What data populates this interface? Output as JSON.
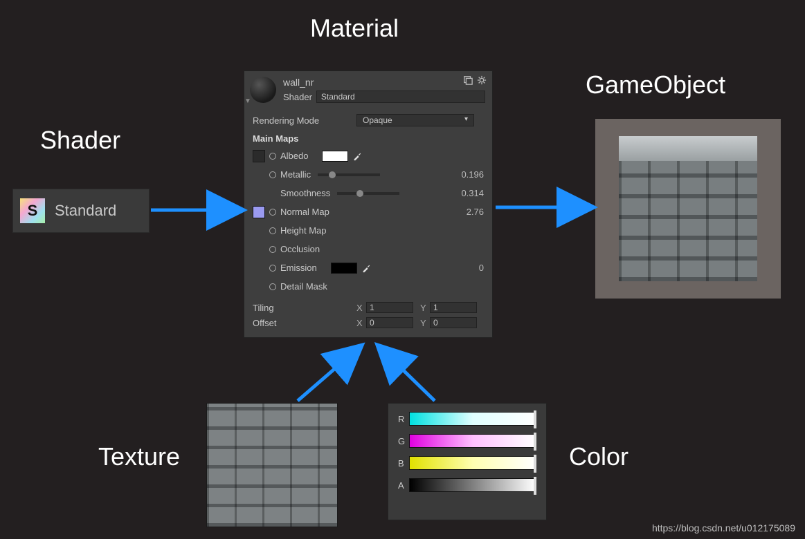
{
  "labels": {
    "material": "Material",
    "shader": "Shader",
    "gameobject": "GameObject",
    "texture": "Texture",
    "color": "Color"
  },
  "shader_block": {
    "icon_letter": "S",
    "name": "Standard"
  },
  "inspector": {
    "material_name": "wall_nr",
    "shader_label": "Shader",
    "shader_value": "Standard",
    "rendering_mode_label": "Rendering Mode",
    "rendering_mode_value": "Opaque",
    "main_maps_label": "Main Maps",
    "albedo_label": "Albedo",
    "metallic_label": "Metallic",
    "metallic_value": "0.196",
    "smoothness_label": "Smoothness",
    "smoothness_value": "0.314",
    "normal_label": "Normal Map",
    "normal_value": "2.76",
    "height_label": "Height Map",
    "occlusion_label": "Occlusion",
    "emission_label": "Emission",
    "emission_value": "0",
    "detail_label": "Detail Mask",
    "tiling_label": "Tiling",
    "tiling_x": "1",
    "tiling_y": "1",
    "offset_label": "Offset",
    "offset_x": "0",
    "offset_y": "0",
    "axis_x": "X",
    "axis_y": "Y"
  },
  "color_panel": {
    "channels": [
      "R",
      "G",
      "B",
      "A"
    ]
  },
  "watermark": "https://blog.csdn.net/u012175089"
}
